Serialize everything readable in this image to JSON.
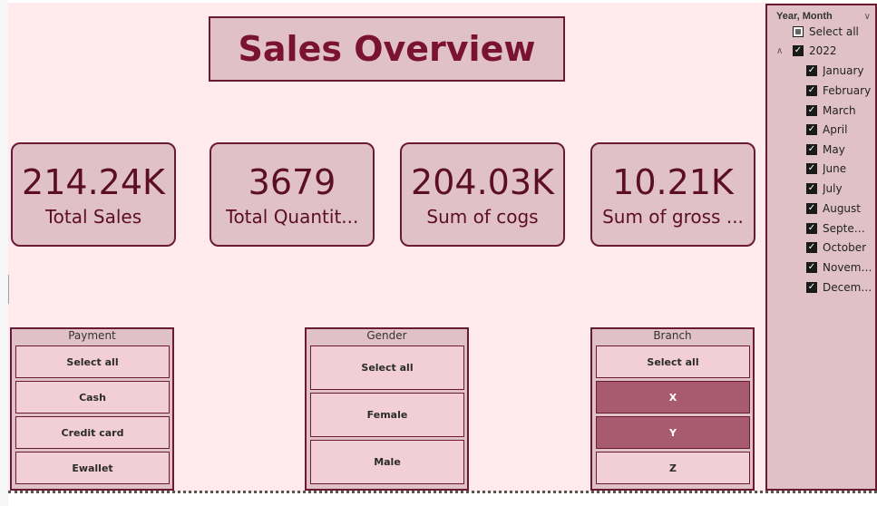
{
  "title": "Sales Overview",
  "kpis": [
    {
      "value": "214.24K",
      "label": "Total Sales"
    },
    {
      "value": "3679",
      "label": "Total Quantit..."
    },
    {
      "value": "204.03K",
      "label": "Sum of cogs"
    },
    {
      "value": "10.21K",
      "label": "Sum of gross ..."
    }
  ],
  "slicers": {
    "payment": {
      "title": "Payment",
      "items": [
        "Select all",
        "Cash",
        "Credit card",
        "Ewallet"
      ]
    },
    "gender": {
      "title": "Gender",
      "items": [
        "Select all",
        "Female",
        "Male"
      ]
    },
    "branch": {
      "title": "Branch",
      "items": [
        "Select all",
        "X",
        "Y",
        "Z"
      ],
      "selected": [
        "X",
        "Y"
      ]
    }
  },
  "year_month": {
    "title": "Year, Month",
    "select_all": "Select all",
    "year": "2022",
    "months": [
      "January",
      "February",
      "March",
      "April",
      "May",
      "June",
      "July",
      "August",
      "Septem...",
      "October",
      "Novemb...",
      "December"
    ]
  },
  "icons": {
    "header_chevron": "chevron-down-icon",
    "year_toggle": "chevron-up-icon",
    "check": "check-icon"
  },
  "colors": {
    "canvas": "#ffebee",
    "card": "#e0c1c8",
    "border": "#6b1a33",
    "title": "#7a1234",
    "selected_item": "#a85a6e"
  }
}
